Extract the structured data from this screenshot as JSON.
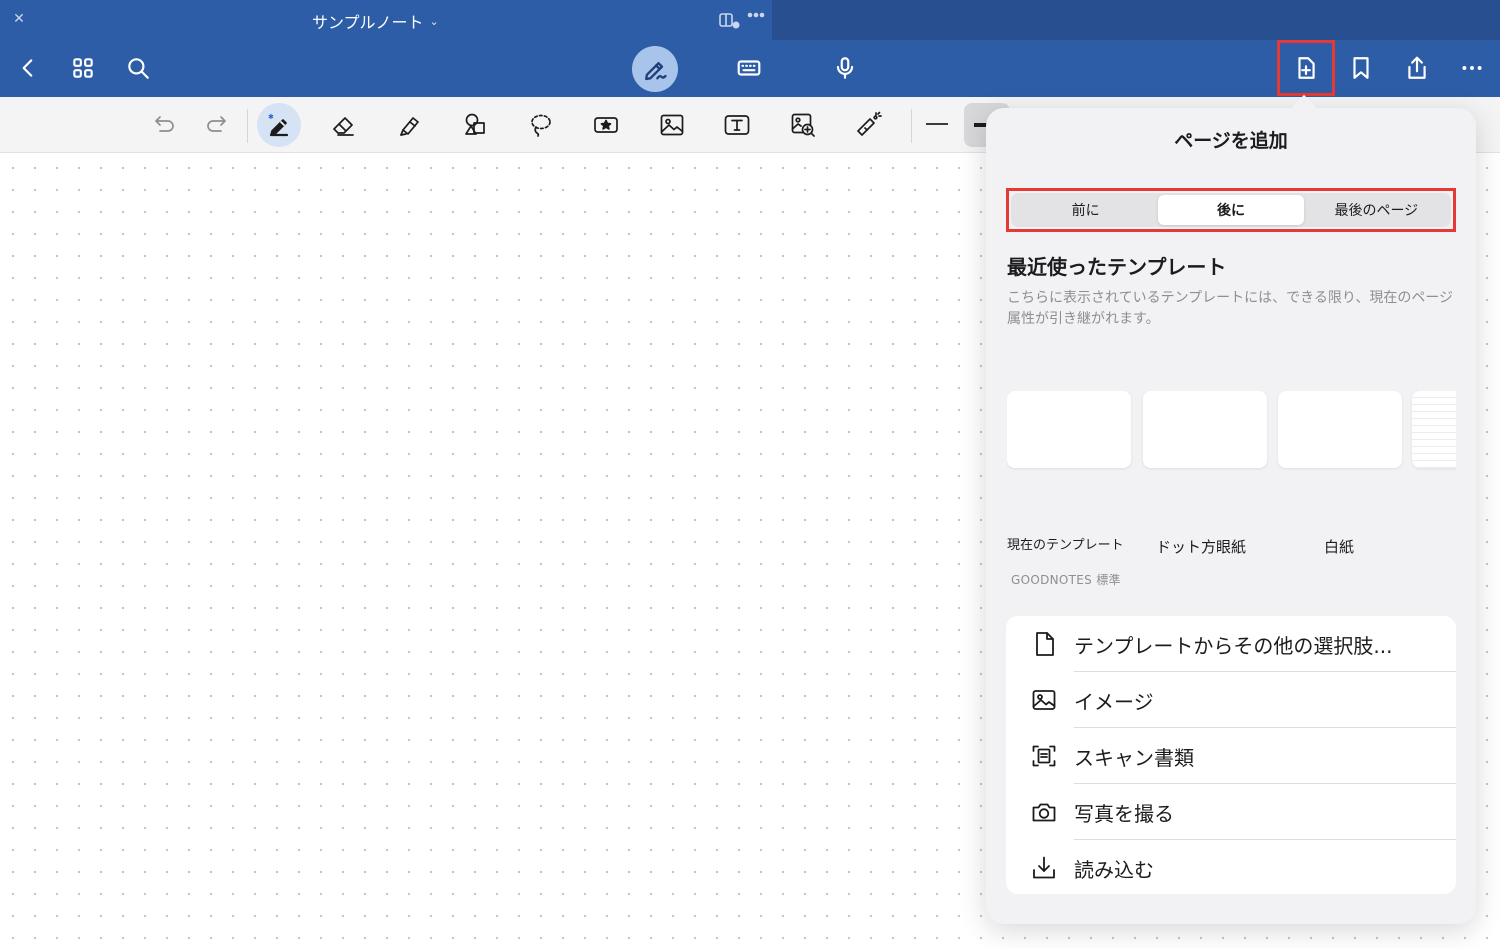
{
  "titlebar": {
    "close_icon": "close-icon",
    "doc_title": "サンプルノート",
    "dropdown_icon": "chevron-down-icon"
  },
  "toolbar": {
    "left": [
      "back-icon",
      "grid-icon",
      "search-icon"
    ],
    "modes": [
      "pen-mode-icon",
      "keyboard-icon",
      "microphone-icon"
    ],
    "right": [
      "add-page-icon",
      "bookmark-icon",
      "share-icon",
      "more-icon"
    ]
  },
  "tools": [
    "undo-icon",
    "redo-icon",
    "pen-icon",
    "eraser-icon",
    "highlighter-icon",
    "shapes-icon",
    "lasso-icon",
    "sticker-icon",
    "image-icon",
    "text-box-icon",
    "zoom-window-icon",
    "laser-pointer-icon"
  ],
  "popover": {
    "title": "ページを追加",
    "segments": [
      "前に",
      "後に",
      "最後のページ"
    ],
    "selected_segment": "後に",
    "recent_title": "最近使ったテンプレート",
    "recent_desc": "こちらに表示されているテンプレートには、できる限り、現在のページ属性が引き継がれます。",
    "templates": [
      {
        "label": "現在のテンプレート",
        "sub": "GOODNOTES 標準"
      },
      {
        "label": "ドット方眼紙",
        "sub": ""
      },
      {
        "label": "白紙",
        "sub": ""
      }
    ],
    "menu": [
      {
        "icon": "document-icon",
        "label": "テンプレートからその他の選択肢..."
      },
      {
        "icon": "photo-icon",
        "label": "イメージ"
      },
      {
        "icon": "scan-document-icon",
        "label": "スキャン書類"
      },
      {
        "icon": "camera-icon",
        "label": "写真を撮る"
      },
      {
        "icon": "import-icon",
        "label": "読み込む"
      }
    ]
  },
  "colors": {
    "toolbar_blue": "#2d5da6",
    "highlight_red": "#e53935",
    "pen_mode_bg": "#a9c4ea"
  }
}
